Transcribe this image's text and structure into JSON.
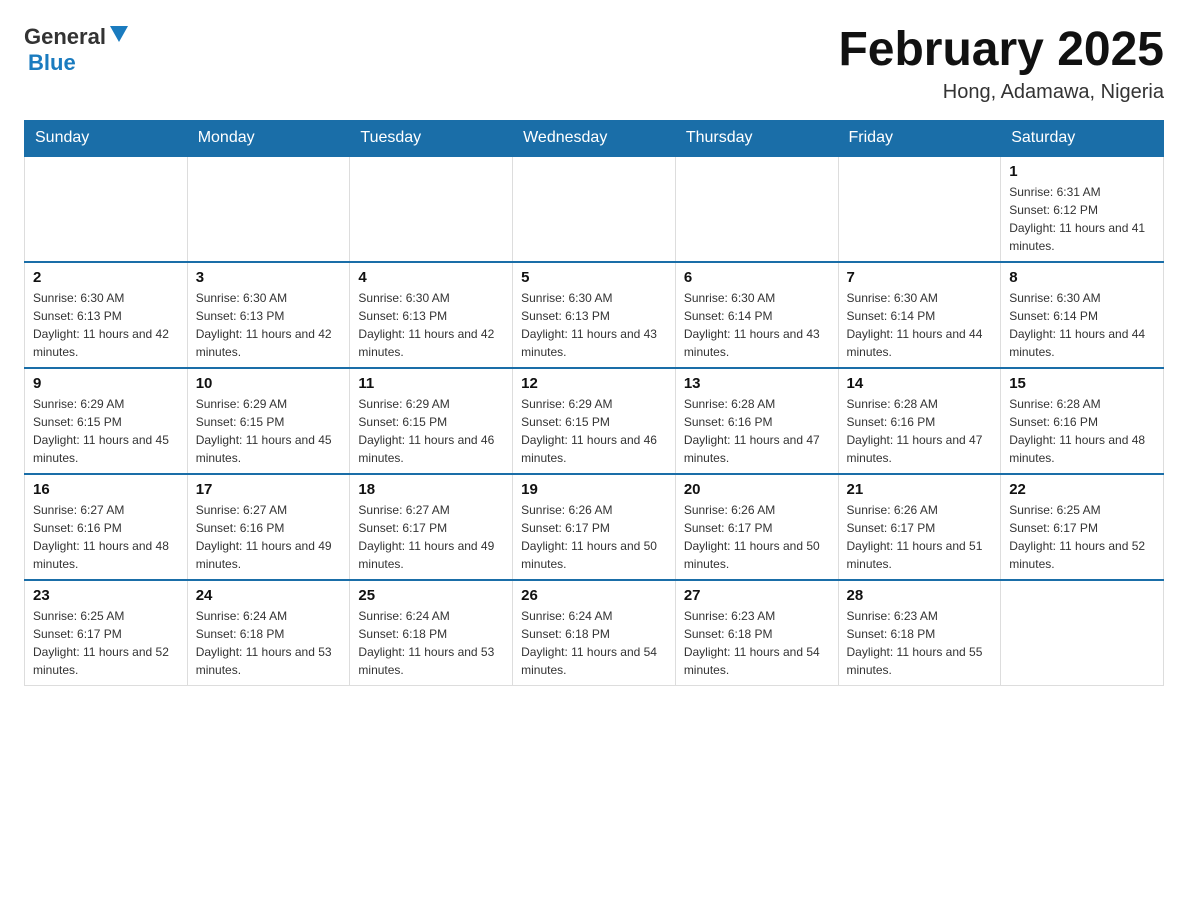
{
  "header": {
    "logo": {
      "general": "General",
      "blue": "Blue"
    },
    "title": "February 2025",
    "location": "Hong, Adamawa, Nigeria"
  },
  "weekdays": [
    "Sunday",
    "Monday",
    "Tuesday",
    "Wednesday",
    "Thursday",
    "Friday",
    "Saturday"
  ],
  "weeks": [
    [
      {
        "day": "",
        "sunrise": "",
        "sunset": "",
        "daylight": ""
      },
      {
        "day": "",
        "sunrise": "",
        "sunset": "",
        "daylight": ""
      },
      {
        "day": "",
        "sunrise": "",
        "sunset": "",
        "daylight": ""
      },
      {
        "day": "",
        "sunrise": "",
        "sunset": "",
        "daylight": ""
      },
      {
        "day": "",
        "sunrise": "",
        "sunset": "",
        "daylight": ""
      },
      {
        "day": "",
        "sunrise": "",
        "sunset": "",
        "daylight": ""
      },
      {
        "day": "1",
        "sunrise": "Sunrise: 6:31 AM",
        "sunset": "Sunset: 6:12 PM",
        "daylight": "Daylight: 11 hours and 41 minutes."
      }
    ],
    [
      {
        "day": "2",
        "sunrise": "Sunrise: 6:30 AM",
        "sunset": "Sunset: 6:13 PM",
        "daylight": "Daylight: 11 hours and 42 minutes."
      },
      {
        "day": "3",
        "sunrise": "Sunrise: 6:30 AM",
        "sunset": "Sunset: 6:13 PM",
        "daylight": "Daylight: 11 hours and 42 minutes."
      },
      {
        "day": "4",
        "sunrise": "Sunrise: 6:30 AM",
        "sunset": "Sunset: 6:13 PM",
        "daylight": "Daylight: 11 hours and 42 minutes."
      },
      {
        "day": "5",
        "sunrise": "Sunrise: 6:30 AM",
        "sunset": "Sunset: 6:13 PM",
        "daylight": "Daylight: 11 hours and 43 minutes."
      },
      {
        "day": "6",
        "sunrise": "Sunrise: 6:30 AM",
        "sunset": "Sunset: 6:14 PM",
        "daylight": "Daylight: 11 hours and 43 minutes."
      },
      {
        "day": "7",
        "sunrise": "Sunrise: 6:30 AM",
        "sunset": "Sunset: 6:14 PM",
        "daylight": "Daylight: 11 hours and 44 minutes."
      },
      {
        "day": "8",
        "sunrise": "Sunrise: 6:30 AM",
        "sunset": "Sunset: 6:14 PM",
        "daylight": "Daylight: 11 hours and 44 minutes."
      }
    ],
    [
      {
        "day": "9",
        "sunrise": "Sunrise: 6:29 AM",
        "sunset": "Sunset: 6:15 PM",
        "daylight": "Daylight: 11 hours and 45 minutes."
      },
      {
        "day": "10",
        "sunrise": "Sunrise: 6:29 AM",
        "sunset": "Sunset: 6:15 PM",
        "daylight": "Daylight: 11 hours and 45 minutes."
      },
      {
        "day": "11",
        "sunrise": "Sunrise: 6:29 AM",
        "sunset": "Sunset: 6:15 PM",
        "daylight": "Daylight: 11 hours and 46 minutes."
      },
      {
        "day": "12",
        "sunrise": "Sunrise: 6:29 AM",
        "sunset": "Sunset: 6:15 PM",
        "daylight": "Daylight: 11 hours and 46 minutes."
      },
      {
        "day": "13",
        "sunrise": "Sunrise: 6:28 AM",
        "sunset": "Sunset: 6:16 PM",
        "daylight": "Daylight: 11 hours and 47 minutes."
      },
      {
        "day": "14",
        "sunrise": "Sunrise: 6:28 AM",
        "sunset": "Sunset: 6:16 PM",
        "daylight": "Daylight: 11 hours and 47 minutes."
      },
      {
        "day": "15",
        "sunrise": "Sunrise: 6:28 AM",
        "sunset": "Sunset: 6:16 PM",
        "daylight": "Daylight: 11 hours and 48 minutes."
      }
    ],
    [
      {
        "day": "16",
        "sunrise": "Sunrise: 6:27 AM",
        "sunset": "Sunset: 6:16 PM",
        "daylight": "Daylight: 11 hours and 48 minutes."
      },
      {
        "day": "17",
        "sunrise": "Sunrise: 6:27 AM",
        "sunset": "Sunset: 6:16 PM",
        "daylight": "Daylight: 11 hours and 49 minutes."
      },
      {
        "day": "18",
        "sunrise": "Sunrise: 6:27 AM",
        "sunset": "Sunset: 6:17 PM",
        "daylight": "Daylight: 11 hours and 49 minutes."
      },
      {
        "day": "19",
        "sunrise": "Sunrise: 6:26 AM",
        "sunset": "Sunset: 6:17 PM",
        "daylight": "Daylight: 11 hours and 50 minutes."
      },
      {
        "day": "20",
        "sunrise": "Sunrise: 6:26 AM",
        "sunset": "Sunset: 6:17 PM",
        "daylight": "Daylight: 11 hours and 50 minutes."
      },
      {
        "day": "21",
        "sunrise": "Sunrise: 6:26 AM",
        "sunset": "Sunset: 6:17 PM",
        "daylight": "Daylight: 11 hours and 51 minutes."
      },
      {
        "day": "22",
        "sunrise": "Sunrise: 6:25 AM",
        "sunset": "Sunset: 6:17 PM",
        "daylight": "Daylight: 11 hours and 52 minutes."
      }
    ],
    [
      {
        "day": "23",
        "sunrise": "Sunrise: 6:25 AM",
        "sunset": "Sunset: 6:17 PM",
        "daylight": "Daylight: 11 hours and 52 minutes."
      },
      {
        "day": "24",
        "sunrise": "Sunrise: 6:24 AM",
        "sunset": "Sunset: 6:18 PM",
        "daylight": "Daylight: 11 hours and 53 minutes."
      },
      {
        "day": "25",
        "sunrise": "Sunrise: 6:24 AM",
        "sunset": "Sunset: 6:18 PM",
        "daylight": "Daylight: 11 hours and 53 minutes."
      },
      {
        "day": "26",
        "sunrise": "Sunrise: 6:24 AM",
        "sunset": "Sunset: 6:18 PM",
        "daylight": "Daylight: 11 hours and 54 minutes."
      },
      {
        "day": "27",
        "sunrise": "Sunrise: 6:23 AM",
        "sunset": "Sunset: 6:18 PM",
        "daylight": "Daylight: 11 hours and 54 minutes."
      },
      {
        "day": "28",
        "sunrise": "Sunrise: 6:23 AM",
        "sunset": "Sunset: 6:18 PM",
        "daylight": "Daylight: 11 hours and 55 minutes."
      },
      {
        "day": "",
        "sunrise": "",
        "sunset": "",
        "daylight": ""
      }
    ]
  ]
}
